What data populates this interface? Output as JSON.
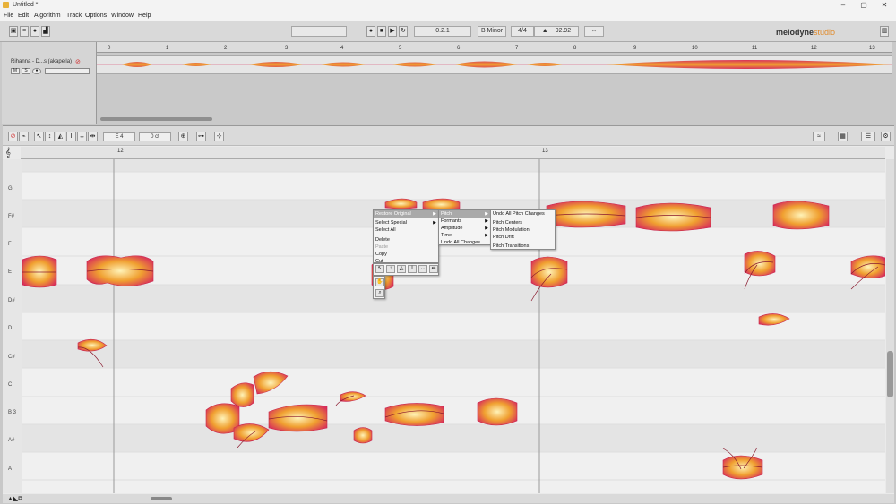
{
  "window": {
    "title": "Untitled *"
  },
  "menubar": [
    "File",
    "Edit",
    "Algorithm",
    "Track",
    "Options",
    "Window",
    "Help"
  ],
  "toolbar": {
    "position": "0.2.1",
    "key": "B Minor",
    "time_sig": "4/4",
    "tempo": "92.92",
    "logo_main": "melodyne",
    "logo_sub": "studio"
  },
  "arrangement": {
    "ruler_marks": [
      "0",
      "1",
      "2",
      "3",
      "4",
      "5",
      "6",
      "7",
      "8",
      "9",
      "10",
      "11",
      "12",
      "13"
    ],
    "track_name": "Rihanna - D...s (akapella)",
    "track_buttons": [
      "M",
      "S"
    ]
  },
  "editor": {
    "pitch_field": "E 4",
    "cents_field": "0 ct",
    "bar_marks": [
      "12",
      "13"
    ],
    "keys": [
      "G",
      "F#",
      "F",
      "E",
      "D#",
      "D",
      "C#",
      "C",
      "B 3",
      "A#",
      "A"
    ]
  },
  "context_menu": {
    "items": [
      {
        "label": "Restore Original",
        "submenu": true,
        "highlight": true
      },
      {
        "label": "Select Special",
        "submenu": true
      },
      {
        "label": "Select All"
      },
      {
        "label": "Delete"
      },
      {
        "label": "Paste",
        "disabled": true
      },
      {
        "label": "Copy"
      },
      {
        "label": "Cut"
      }
    ],
    "sub1": [
      {
        "label": "Pitch",
        "submenu": true,
        "highlight": true
      },
      {
        "label": "Formants",
        "submenu": true
      },
      {
        "label": "Amplitude",
        "submenu": true
      },
      {
        "label": "Time",
        "submenu": true
      },
      {
        "label": "Undo All Changes"
      }
    ],
    "sub2": [
      {
        "label": "Undo All Pitch Changes"
      },
      {
        "label": "Pitch Centers"
      },
      {
        "label": "Pitch Modulation"
      },
      {
        "label": "Pitch Drift"
      },
      {
        "label": "Pitch Transitions"
      }
    ]
  },
  "colors": {
    "blob_outer": "#d8305a",
    "blob_mid": "#f0a030",
    "blob_inner": "#fff3b8"
  }
}
